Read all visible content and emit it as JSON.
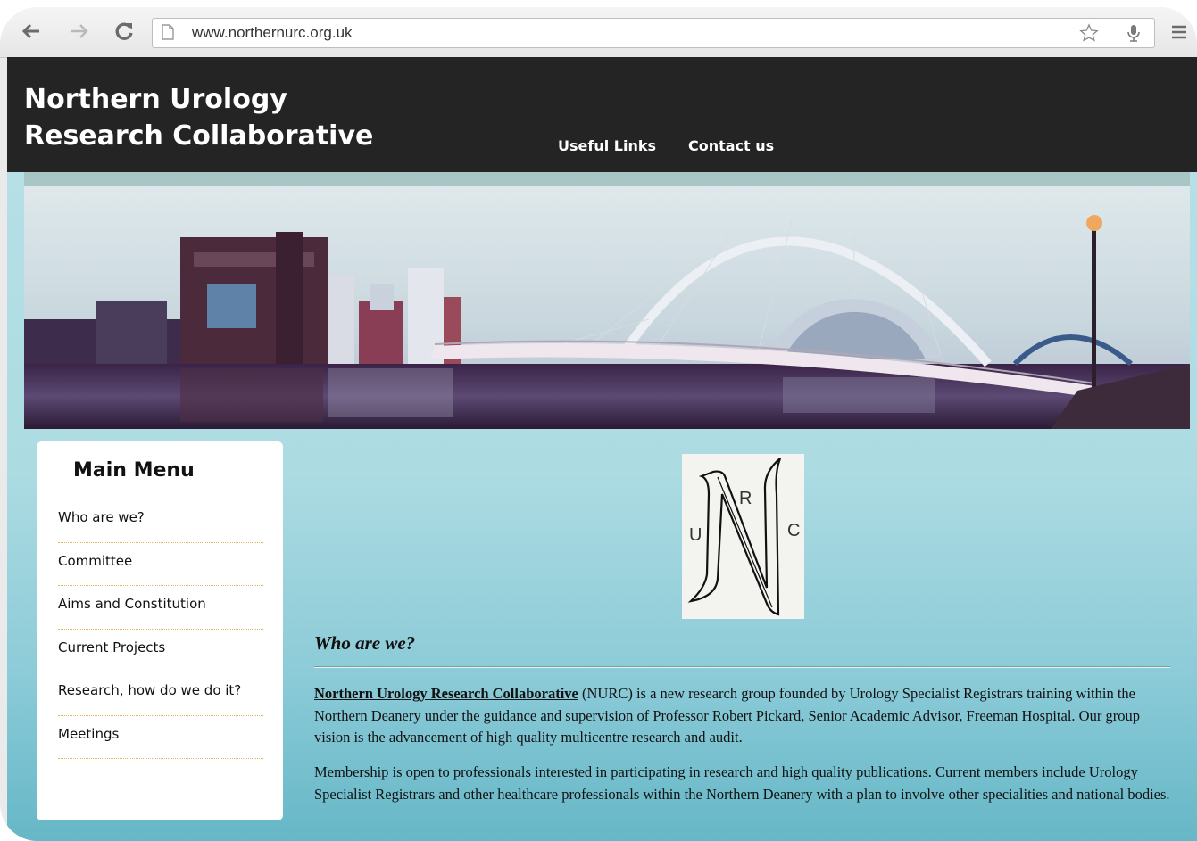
{
  "browser": {
    "url": "www.northernurc.org.uk",
    "icons": {
      "back": "back-arrow-icon",
      "forward": "forward-arrow-icon",
      "reload": "reload-icon",
      "page": "page-icon",
      "bookmark": "star-icon",
      "voice": "microphone-icon",
      "menu": "hamburger-menu-icon"
    }
  },
  "header": {
    "title_line1": "Northern Urology",
    "title_line2": "Research Collaborative",
    "nav": [
      "Useful Links",
      "Contact us"
    ]
  },
  "sidebar": {
    "title": "Main Menu",
    "items": [
      "Who are we?",
      "Committee",
      "Aims and Constitution",
      "Current Projects",
      "Research, how do we do it?",
      "Meetings"
    ]
  },
  "logo": {
    "letters": [
      "U",
      "R",
      "N",
      "C"
    ]
  },
  "content": {
    "heading": "Who are we?",
    "p1_link": "Northern Urology Research Collaborative",
    "p1_text": " (NURC) is a new research group founded by Urology Specialist Registrars training within the Northern Deanery under the guidance and supervision of Professor Robert Pickard, Senior Academic Advisor, Freeman Hospital. Our group vision is the advancement of high quality multicentre research and audit.",
    "p2_text": "Membership is open to professionals interested in participating in research and high quality publications. Current members include Urology Specialist Registrars and other healthcare professionals within the Northern Deanery with a plan to involve other specialities and national bodies."
  },
  "colors": {
    "header_bg": "#242424",
    "body_bg_top": "#b6dfe6",
    "body_bg_bottom": "#66b7c7",
    "menu_divider": "#e0b35c"
  }
}
